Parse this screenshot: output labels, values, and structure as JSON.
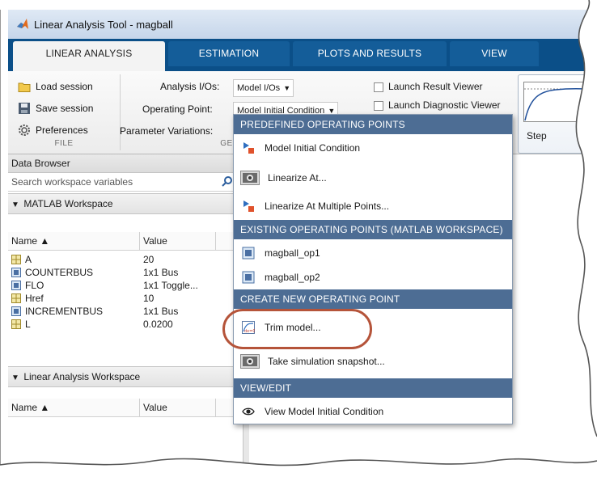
{
  "window": {
    "title": "Linear Analysis Tool - magball"
  },
  "tabs": [
    {
      "label": "LINEAR ANALYSIS",
      "active": true
    },
    {
      "label": "ESTIMATION",
      "active": false
    },
    {
      "label": "PLOTS AND RESULTS",
      "active": false
    },
    {
      "label": "VIEW",
      "active": false
    }
  ],
  "ribbon": {
    "file_buttons": [
      {
        "label": "Load session",
        "icon": "folder-icon"
      },
      {
        "label": "Save session",
        "icon": "save-icon"
      },
      {
        "label": "Preferences",
        "icon": "gear-icon"
      }
    ],
    "file_section": "FILE",
    "general_section": "GE",
    "analysis_ios_label": "Analysis I/Os:",
    "analysis_ios_value": "Model I/Os",
    "operating_point_label": "Operating Point:",
    "operating_point_value": "Model Initial Condition",
    "param_variations_label": "Parameter Variations:",
    "checkboxes": [
      {
        "label": "Launch Result Viewer",
        "checked": false
      },
      {
        "label": "Launch Diagnostic Viewer",
        "checked": false
      }
    ],
    "step_label": "Step"
  },
  "data_browser": {
    "title": "Data Browser",
    "search_placeholder": "Search workspace variables",
    "matlab_ws": {
      "label": "MATLAB Workspace",
      "col_name": "Name ▲",
      "col_value": "Value",
      "rows": [
        {
          "name": "A",
          "value": "20",
          "icon": "matrix-icon"
        },
        {
          "name": "COUNTERBUS",
          "value": "1x1 Bus",
          "icon": "object-icon"
        },
        {
          "name": "FLO",
          "value": "1x1 Toggle...",
          "icon": "object-icon"
        },
        {
          "name": "Href",
          "value": "10",
          "icon": "matrix-icon"
        },
        {
          "name": "INCREMENTBUS",
          "value": "1x1 Bus",
          "icon": "object-icon"
        },
        {
          "name": "L",
          "value": "0.0200",
          "icon": "matrix-icon"
        }
      ]
    },
    "lin_ws": {
      "label": "Linear Analysis Workspace",
      "col_name": "Name ▲",
      "col_value": "Value"
    }
  },
  "menu": {
    "predefined_header": "PREDEFINED OPERATING POINTS",
    "predefined_items": [
      {
        "label": "Model Initial Condition",
        "icon": "model-op-icon"
      },
      {
        "label": "Linearize At...",
        "icon": "camera-icon"
      },
      {
        "label": "Linearize At Multiple Points...",
        "icon": "model-op-icon"
      }
    ],
    "existing_header": "EXISTING OPERATING POINTS (MATLAB WORKSPACE)",
    "existing_items": [
      {
        "label": "magball_op1",
        "icon": "object-icon"
      },
      {
        "label": "magball_op2",
        "icon": "object-icon"
      }
    ],
    "create_header": "CREATE NEW OPERATING POINT",
    "create_items": [
      {
        "label": "Trim model...",
        "icon": "trim-icon"
      },
      {
        "label": "Take simulation snapshot...",
        "icon": "camera-icon"
      }
    ],
    "view_header": "VIEW/EDIT",
    "view_items": [
      {
        "label": "View Model Initial Condition",
        "icon": "eye-icon"
      }
    ]
  },
  "colors": {
    "tab_strip": "#0b4f88",
    "menu_header": "#4d6d94",
    "highlight_ring": "#b5543a"
  }
}
